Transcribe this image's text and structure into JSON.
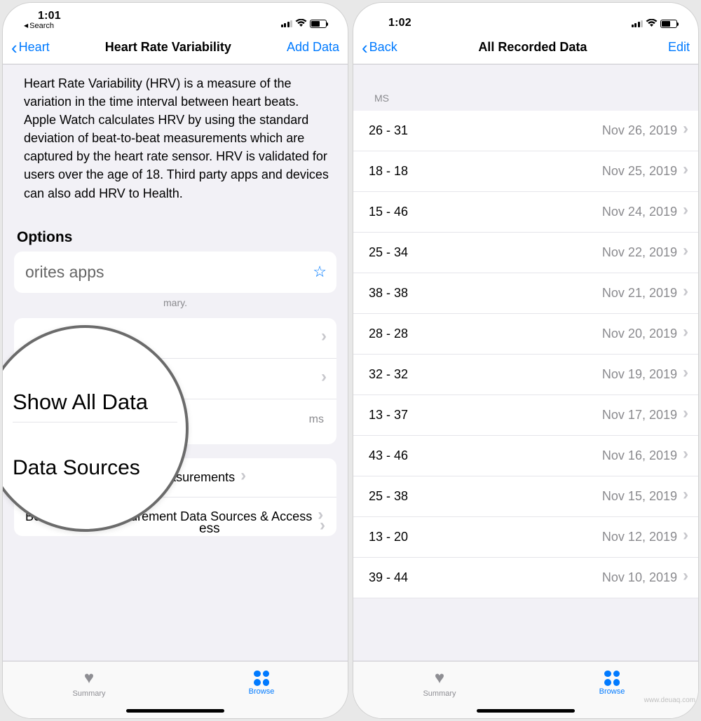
{
  "left": {
    "status": {
      "time": "1:01",
      "backapp": "Search"
    },
    "nav": {
      "back": "Heart",
      "title": "Heart Rate Variability",
      "action": "Add Data"
    },
    "description": "Heart Rate Variability (HRV) is a measure of the variation in the time interval between heart beats. Apple Watch calculates HRV by using the standard deviation of beat-to-beat measurements which are captured by the heart rate sensor. HRV is validated for users over the age of 18. Third party apps and devices can also add HRV to Health.",
    "options_header": "Options",
    "fav_row": "orites apps",
    "fav_hint": "mary.",
    "mag": {
      "line1": "",
      "line2": "Show All Data",
      "line3": "Data Sources"
    },
    "access_frag": "ess",
    "unit": "ms",
    "rows": {
      "beat_measurements": "Show All Beat-to-Beat Measurements",
      "beat_sources": "Beat-to-Beat Measurement Data Sources & Access"
    },
    "tabs": {
      "summary": "Summary",
      "browse": "Browse"
    }
  },
  "right": {
    "status": {
      "time": "1:02"
    },
    "nav": {
      "back": "Back",
      "title": "All Recorded Data",
      "action": "Edit"
    },
    "list_header": "MS",
    "rows": [
      {
        "value": "26 - 31",
        "date": "Nov 26, 2019"
      },
      {
        "value": "18 - 18",
        "date": "Nov 25, 2019"
      },
      {
        "value": "15 - 46",
        "date": "Nov 24, 2019"
      },
      {
        "value": "25 - 34",
        "date": "Nov 22, 2019"
      },
      {
        "value": "38 - 38",
        "date": "Nov 21, 2019"
      },
      {
        "value": "28 - 28",
        "date": "Nov 20, 2019"
      },
      {
        "value": "32 - 32",
        "date": "Nov 19, 2019"
      },
      {
        "value": "13 - 37",
        "date": "Nov 17, 2019"
      },
      {
        "value": "43 - 46",
        "date": "Nov 16, 2019"
      },
      {
        "value": "25 - 38",
        "date": "Nov 15, 2019"
      },
      {
        "value": "13 - 20",
        "date": "Nov 12, 2019"
      },
      {
        "value": "39 - 44",
        "date": "Nov 10, 2019"
      }
    ],
    "tabs": {
      "summary": "Summary",
      "browse": "Browse"
    }
  },
  "watermark": "www.deuaq.com"
}
